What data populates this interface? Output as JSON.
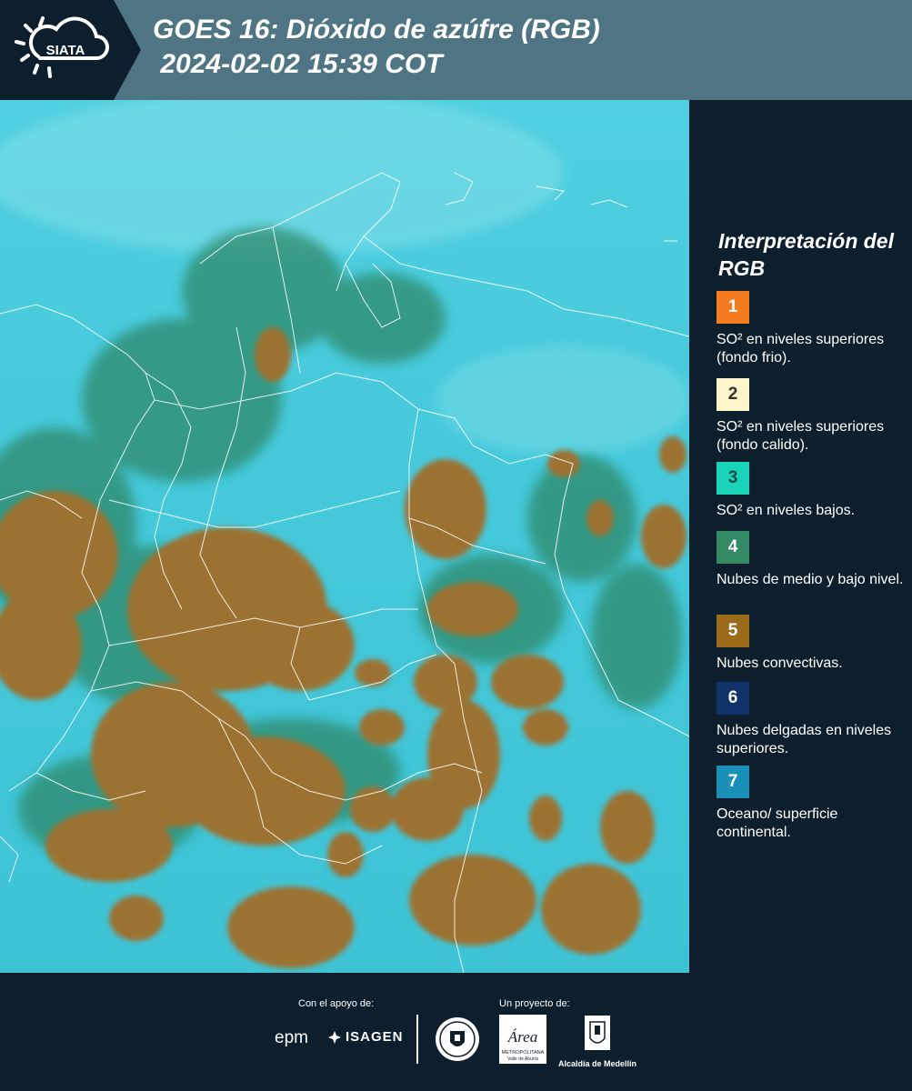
{
  "header": {
    "logo_text": "SIATA",
    "title": "GOES 16: Dióxido de azúfre (RGB)\n 2024-02-02 15:39 COT"
  },
  "legend": {
    "title": "Interpretación del RGB",
    "items": [
      {
        "number": "1",
        "label": "SO² en niveles superiores (fondo frio).",
        "color": "#f47c1e",
        "text_color": "#ffffff"
      },
      {
        "number": "2",
        "label": "SO² en niveles superiores (fondo calido).",
        "color": "#fbf5c9",
        "text_color": "#333333"
      },
      {
        "number": "3",
        "label": "SO² en niveles bajos.",
        "color": "#19d3b9",
        "text_color": "#1b4b46"
      },
      {
        "number": "4",
        "label": "Nubes de medio y bajo nivel.",
        "color": "#348a64",
        "text_color": "#ffffff"
      },
      {
        "number": "5",
        "label": "Nubes convectivas.",
        "color": "#9c6a1b",
        "text_color": "#ffffff"
      },
      {
        "number": "6",
        "label": "Nubes delgadas en niveles superiores.",
        "color": "#10336b",
        "text_color": "#ffffff"
      },
      {
        "number": "7",
        "label": "Oceano/ superficie continental.",
        "color": "#1a8fb8",
        "text_color": "#ffffff"
      }
    ]
  },
  "footer": {
    "support_label": "Con el apoyo de:",
    "project_label": "Un proyecto de:",
    "epm": "epm",
    "isagen": "ISAGEN",
    "area_text": "Área",
    "area_subtitle": "METROPOLITANA",
    "area_subtitle2": "Valle de Aburrá",
    "alcaldia": "Alcaldía de Medellín"
  },
  "colors": {
    "header_bg": "#4f7585",
    "panel_bg": "#0d1f2d",
    "ocean": "#46c6d8",
    "cloud_brown": "#9c7230",
    "cloud_green": "#2f8a6a"
  }
}
